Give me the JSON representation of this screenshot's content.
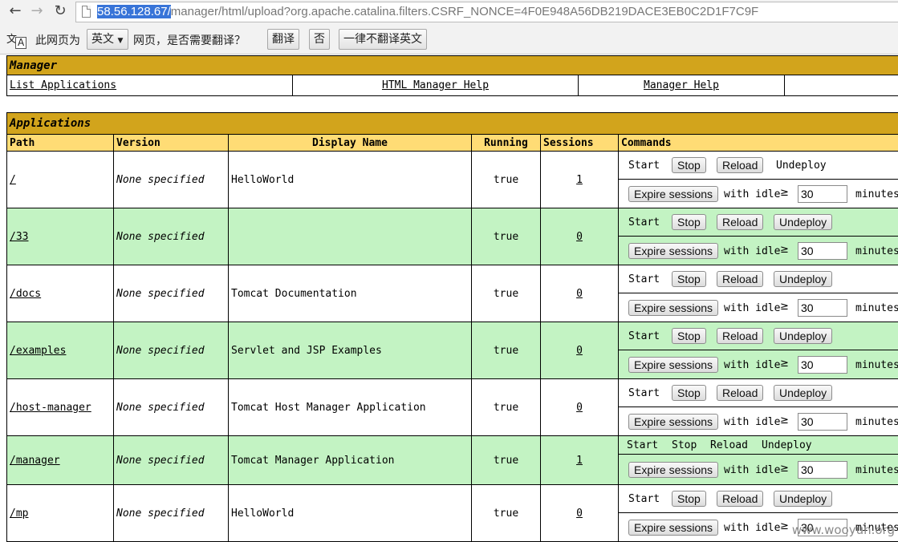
{
  "browser": {
    "url_host": "58.56.128.67/",
    "url_rest": "manager/html/upload?org.apache.catalina.filters.CSRF_NONCE=4F0E948A56DB219DACE3EB0C2D1F7C9F",
    "nav_icons": [
      "back-arrow",
      "forward-arrow",
      "reload"
    ]
  },
  "translate_bar": {
    "prompt_prefix": "此网页为",
    "language": "英文",
    "prompt_suffix": "网页，是否需要翻译？",
    "translate_button": "翻译",
    "no_button": "否",
    "never_button": "一律不翻译英文"
  },
  "manager": {
    "title": "Manager",
    "links": [
      "List Applications",
      "HTML Manager Help",
      "Manager Help"
    ]
  },
  "applications": {
    "title": "Applications",
    "headers": [
      "Path",
      "Version",
      "Display Name",
      "Running",
      "Sessions",
      "Commands"
    ],
    "labels": {
      "start": "Start",
      "stop": "Stop",
      "reload": "Reload",
      "undeploy": "Undeploy",
      "expire": "Expire sessions",
      "with_idle": "with idle",
      "ge": "≥",
      "minutes": "minutes"
    },
    "rows": [
      {
        "path": "/",
        "version": "None specified",
        "display_name": "HelloWorld",
        "running": "true",
        "sessions": "1",
        "idle": "30",
        "bg": "white",
        "undeploy_button": false,
        "manager": false
      },
      {
        "path": "/33",
        "version": "None specified",
        "display_name": "",
        "running": "true",
        "sessions": "0",
        "idle": "30",
        "bg": "green",
        "undeploy_button": true,
        "manager": false
      },
      {
        "path": "/docs",
        "version": "None specified",
        "display_name": "Tomcat Documentation",
        "running": "true",
        "sessions": "0",
        "idle": "30",
        "bg": "white",
        "undeploy_button": true,
        "manager": false
      },
      {
        "path": "/examples",
        "version": "None specified",
        "display_name": "Servlet and JSP Examples",
        "running": "true",
        "sessions": "0",
        "idle": "30",
        "bg": "green",
        "undeploy_button": true,
        "manager": false
      },
      {
        "path": "/host-manager",
        "version": "None specified",
        "display_name": "Tomcat Host Manager Application",
        "running": "true",
        "sessions": "0",
        "idle": "30",
        "bg": "white",
        "undeploy_button": true,
        "manager": false
      },
      {
        "path": "/manager",
        "version": "None specified",
        "display_name": "Tomcat Manager Application",
        "running": "true",
        "sessions": "1",
        "idle": "30",
        "bg": "green",
        "undeploy_button": true,
        "manager": true
      },
      {
        "path": "/mp",
        "version": "None specified",
        "display_name": "HelloWorld",
        "running": "true",
        "sessions": "0",
        "idle": "30",
        "bg": "white",
        "undeploy_button": true,
        "manager": false
      }
    ]
  },
  "watermark": "www.wooyun.org"
}
